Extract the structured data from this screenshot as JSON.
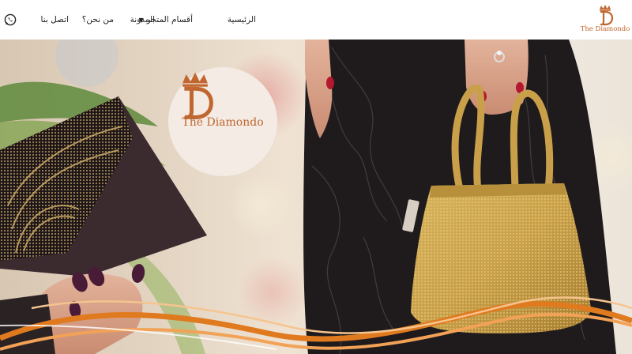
{
  "header": {
    "brand": "The Diamondo",
    "nav": [
      {
        "id": "home",
        "label": "الرئيسية"
      },
      {
        "id": "store",
        "label": "أقسام المتجر",
        "has_dropdown": true
      },
      {
        "id": "blog",
        "label": "المدونة"
      },
      {
        "id": "about",
        "label": "من نحن؟"
      },
      {
        "id": "contact",
        "label": "اتصل بنا"
      }
    ],
    "icons": {
      "whatsapp": "whatsapp-icon",
      "dropdown": "chevron-down-icon"
    }
  },
  "hero": {
    "brand": "The Diamondo",
    "colors": {
      "brand": "#c0662e",
      "logo_bg": "#f4ebe5",
      "gold": "#c9a049",
      "wave": "#e07a1f"
    }
  }
}
